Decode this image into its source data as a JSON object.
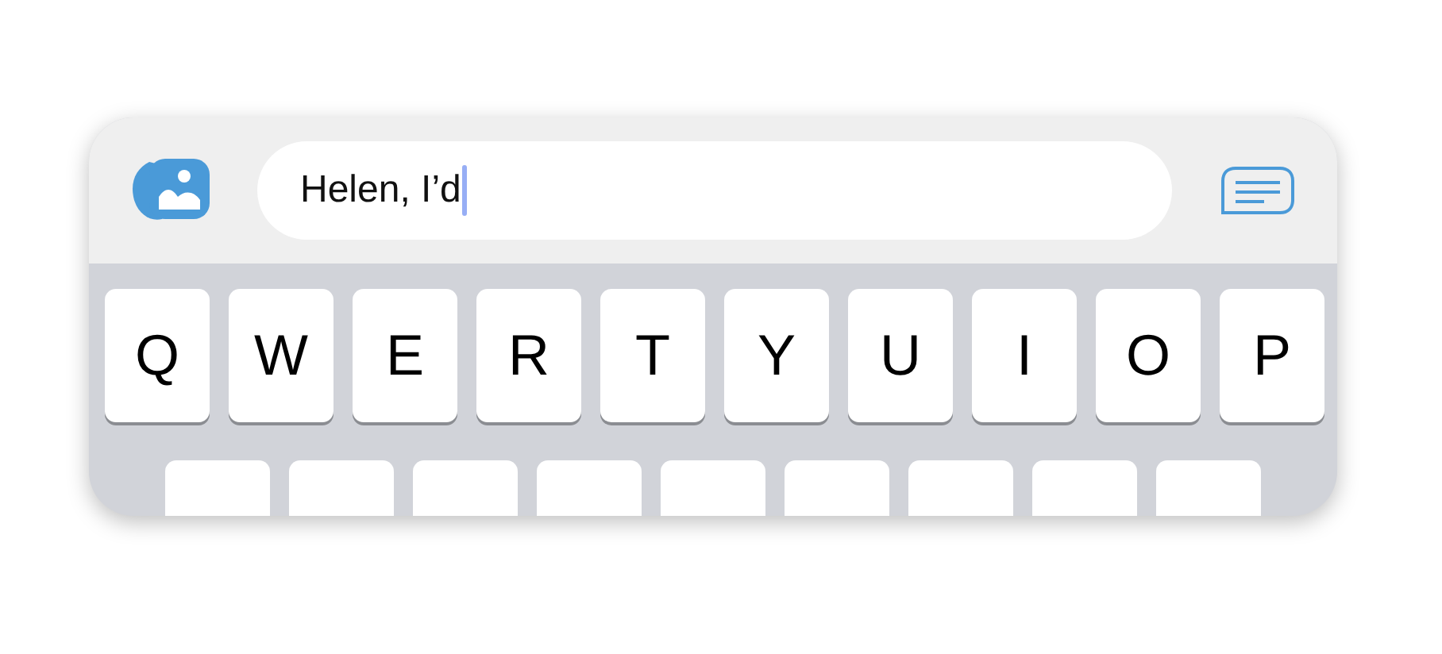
{
  "message_field": {
    "value": "Helen, I’d",
    "caret": true
  },
  "keyboard": {
    "rows": [
      {
        "keys": [
          {
            "kind": "letter",
            "label": "Q"
          },
          {
            "kind": "letter",
            "label": "W"
          },
          {
            "kind": "letter",
            "label": "E"
          },
          {
            "kind": "letter",
            "label": "R"
          },
          {
            "kind": "letter",
            "label": "T"
          },
          {
            "kind": "letter",
            "label": "Y"
          },
          {
            "kind": "letter",
            "label": "U"
          },
          {
            "kind": "letter",
            "label": "I"
          },
          {
            "kind": "letter",
            "label": "O"
          },
          {
            "kind": "letter",
            "label": "P"
          }
        ]
      },
      {
        "keys": [
          {
            "kind": "hidden"
          },
          {
            "kind": "hidden"
          },
          {
            "kind": "hidden"
          },
          {
            "kind": "hidden"
          },
          {
            "kind": "hidden"
          },
          {
            "kind": "hidden"
          },
          {
            "kind": "hidden"
          },
          {
            "kind": "hidden"
          },
          {
            "kind": "hidden"
          }
        ]
      }
    ]
  }
}
